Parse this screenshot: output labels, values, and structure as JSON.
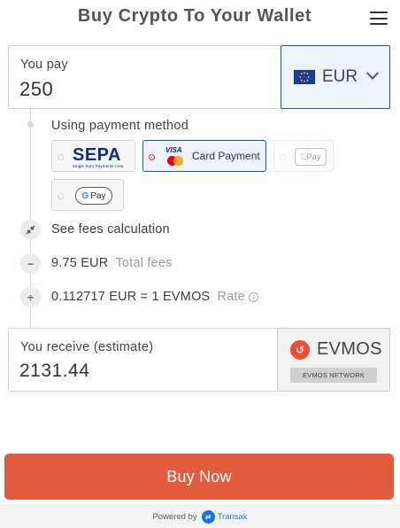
{
  "header": {
    "title": "Buy Crypto To Your Wallet",
    "menu_icon": "hamburger-menu-icon"
  },
  "pay": {
    "label": "You pay",
    "value": "250",
    "currency": "EUR",
    "currency_flag": "eu-flag-icon"
  },
  "payment_method": {
    "label": "Using payment method",
    "options": [
      {
        "id": "sepa",
        "logo_text": "SEPA",
        "logo_subtext": "Single Euro Payments Area",
        "selected": false
      },
      {
        "id": "card",
        "label": "Card Payment",
        "logo_text": "VISA",
        "selected": true
      },
      {
        "id": "apple_pay",
        "logo_text": "Pay",
        "selected": false,
        "disabled": true
      },
      {
        "id": "google_pay",
        "logo_text": "Pay",
        "selected": false
      }
    ]
  },
  "fees": {
    "calc_label": "See fees calculation",
    "total_fees_value": "9.75 EUR",
    "total_fees_label": "Total fees",
    "rate_value": "0.112717 EUR = 1 EVMOS",
    "rate_label": "Rate"
  },
  "receive": {
    "label": "You receive (estimate)",
    "value": "2131.44",
    "crypto": "EVMOS",
    "network": "EVMOS NETWORK"
  },
  "buy_button": "Buy Now",
  "footer": {
    "powered_by": "Powered by",
    "brand": "Transak"
  },
  "colors": {
    "accent": "#e35b3f",
    "selected_border": "#2f4f8a",
    "selected_bg": "#edf1f8",
    "sepa_blue": "#10298e"
  }
}
